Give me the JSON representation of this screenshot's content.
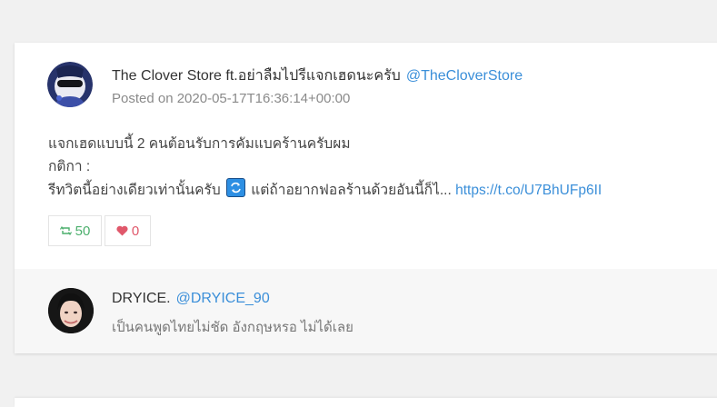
{
  "tweet": {
    "user_name": "The Clover Store ft.อย่าลืมไปรีแจกเฮดนะครับ",
    "user_handle": "@TheCloverStore",
    "posted": "Posted on 2020-05-17T16:36:14+00:00",
    "line1": "แจกเฮดแบบนี้ 2 คนต้อนรับการคัมแบคร้านครับผม",
    "line2": "กติกา :",
    "line3_a": "รีทวิตนี้อย่างเดียวเท่านั้นครับ",
    "line3_b": "แต่ถ้าอยากฟอลร้านด้วยอันนี้ก็ไ...",
    "link": "https://t.co/U7BhUFp6II",
    "retweet_count": "50",
    "like_count": "0",
    "icons": {
      "avatar": "avatar-image",
      "retweet_emoji": "repeat-emoji-icon",
      "retweet": "retweet-icon",
      "like": "heart-icon"
    }
  },
  "reply": {
    "user_name": "DRYICE.",
    "user_handle": "@DRYICE_90",
    "text": "เป็นคนพูดไทยไม่ชัด อังกฤษหรอ ไม่ได้เลย"
  },
  "colors": {
    "link": "#3b8fd9",
    "retweet": "#4caf6d",
    "like": "#e0586b",
    "page_bg": "#f1f1f1",
    "reply_bg": "#f7f7f7"
  }
}
